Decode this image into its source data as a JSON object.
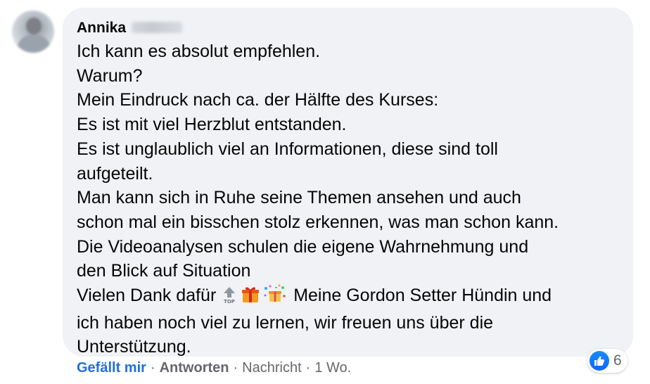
{
  "comment": {
    "author_first_name": "Annika",
    "lines": [
      "Ich kann es absolut empfehlen.",
      "Warum?",
      "Mein Eindruck nach ca. der Hälfte des Kurses:",
      "Es ist mit viel Herzblut entstanden.",
      "Es ist unglaublich viel an Informationen, diese sind toll",
      "aufgeteilt.",
      "Man kann sich in Ruhe seine Themen ansehen und auch",
      "schon mal ein bisschen stolz erkennen, was man schon kann.",
      "Die Videoanalysen schulen die eigene Wahrnehmung und",
      "den Blick auf Situation"
    ],
    "emoji_line_prefix": "Vielen Dank dafür",
    "emoji_icons": [
      "top-arrow-emoji",
      "gift-emoji",
      "confetti-gift-emoji"
    ],
    "emoji_line_suffix": "Meine Gordon Setter Hündin und",
    "closing_lines": [
      "ich haben noch viel zu lernen, wir freuen uns über die",
      "Unterstützung."
    ]
  },
  "reactions": {
    "icon": "like-thumb-icon",
    "count": "6",
    "color": "#0866ff"
  },
  "actions": {
    "like_label": "Gefällt mir",
    "reply_label": "Antworten",
    "message_label": "Nachricht",
    "time_label": "1 Wo.",
    "separator": "·"
  },
  "colors": {
    "bubble": "#f0f2f5",
    "text": "#050505",
    "secondary": "#65676b",
    "like_link": "#216fdb"
  }
}
